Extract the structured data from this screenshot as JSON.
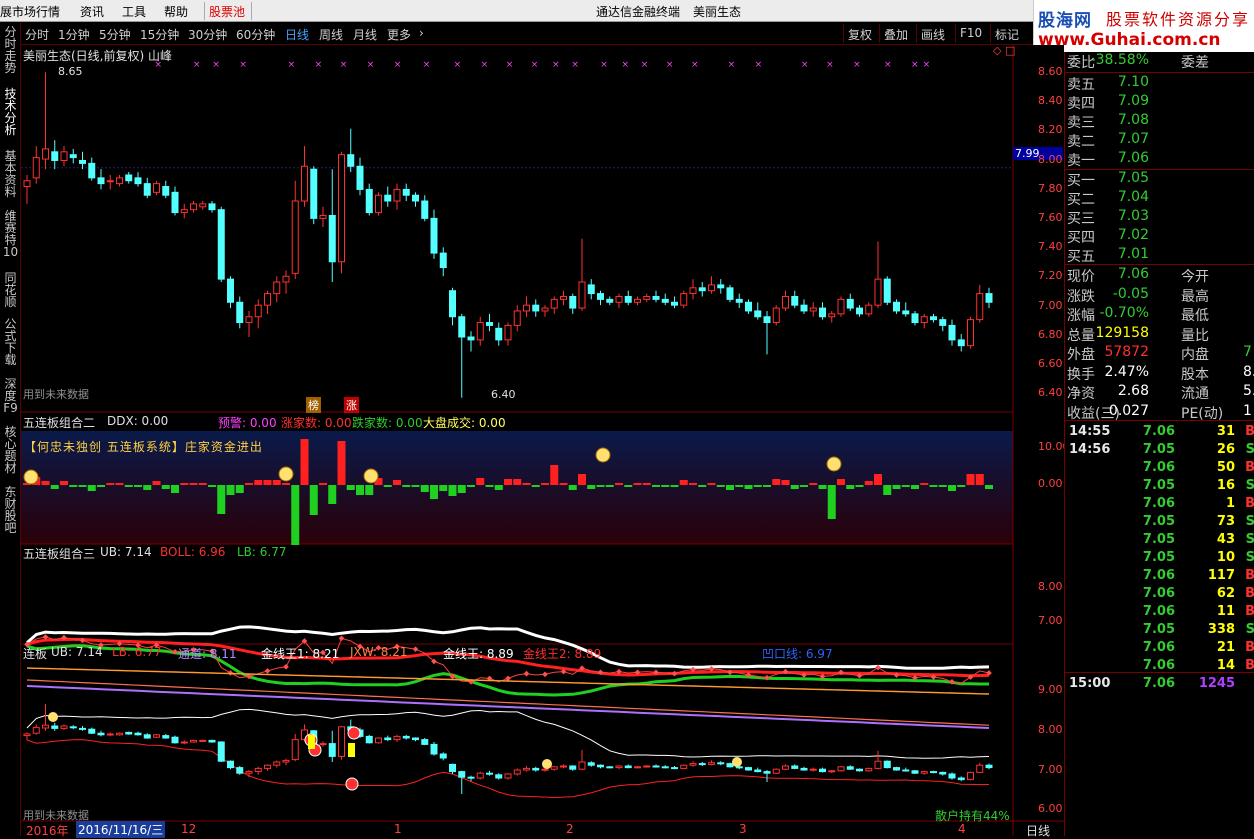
{
  "menu": {
    "items": [
      "展市场行情",
      "资讯",
      "工具",
      "帮助"
    ],
    "highlight": "股票池",
    "app_title": "通达信金融终端",
    "stock_title": "美丽生态"
  },
  "logo": {
    "name": "股海网",
    "tagline": "股票软件资源分享",
    "url": "www.Guhai.com.cn"
  },
  "side_tabs": [
    "分时走势",
    "技术分析",
    "基本资料",
    "维赛特10",
    "同花顺",
    "公式下载",
    "深度F9",
    "核心题材",
    "东财股吧"
  ],
  "periods": [
    "分时",
    "1分钟",
    "5分钟",
    "15分钟",
    "30分钟",
    "60分钟",
    "日线",
    "周线",
    "月线",
    "更多"
  ],
  "active_period": "日线",
  "toolbar_right": [
    "复权",
    "叠加",
    "画线",
    "F10",
    "标记"
  ],
  "main_panel": {
    "title": "美丽生态(日线,前复权) 山峰",
    "high_label": "8.65",
    "low_label": "6.40",
    "marker_a": "榜",
    "marker_b": "涨",
    "footer": "用到未来数据",
    "price_tag": "7.99",
    "y_ticks": [
      "8.60",
      "8.40",
      "8.20",
      "8.00",
      "7.80",
      "7.60",
      "7.40",
      "7.20",
      "7.00",
      "6.80",
      "6.60",
      "6.40"
    ]
  },
  "panel2": {
    "name": "五连板组合二",
    "ddx": "DDX: 0.00",
    "yujing": "预警: 0.00",
    "zhangjia": "涨家数: 0.00",
    "diejia": "跌家数: 0.00",
    "dapan": "大盘成交: 0.00",
    "banner": "【何忠未独创 五连板系统】庄家资金进出",
    "y_ticks": [
      "10.00",
      "0.00"
    ]
  },
  "panel3": {
    "name": "五连板组合三",
    "ub": "UB: 7.14",
    "boll": "BOLL: 6.96",
    "lb": "LB: 6.77",
    "y_ticks": [
      "8.00",
      "7.00"
    ]
  },
  "panel4": {
    "name": "连板",
    "ub": "UB: 7.14",
    "lb": "LB: 6.77",
    "tongdao": "通道: 8.11",
    "jxw1": "金线王1: 8.21",
    "jxw": "JXW: 8.21",
    "jxwang": "金线王: 8.89",
    "jxw2": "金线王2: 8.89",
    "aotu": "凹口线: 6.97",
    "footer": "用到未来数据",
    "retail": "散户持有44%",
    "y_ticks": [
      "9.00",
      "8.00",
      "7.00",
      "6.00"
    ]
  },
  "date_axis": {
    "labels": [
      "2016年",
      "2016/11/16/三",
      "12",
      "1",
      "2",
      "3",
      "4"
    ],
    "period": "日线"
  },
  "quote": {
    "weibi": {
      "k": "委比",
      "v": "-38.58%",
      "k2": "委差"
    },
    "asks": [
      {
        "k": "卖五",
        "v": "7.10"
      },
      {
        "k": "卖四",
        "v": "7.09"
      },
      {
        "k": "卖三",
        "v": "7.08"
      },
      {
        "k": "卖二",
        "v": "7.07"
      },
      {
        "k": "卖一",
        "v": "7.06"
      }
    ],
    "bids": [
      {
        "k": "买一",
        "v": "7.05"
      },
      {
        "k": "买二",
        "v": "7.04"
      },
      {
        "k": "买三",
        "v": "7.03"
      },
      {
        "k": "买四",
        "v": "7.02"
      },
      {
        "k": "买五",
        "v": "7.01"
      }
    ],
    "stats": [
      {
        "k": "现价",
        "v": "7.06",
        "k2": "今开"
      },
      {
        "k": "涨跌",
        "v": "-0.05",
        "k2": "最高"
      },
      {
        "k": "涨幅",
        "v": "-0.70%",
        "k2": "最低"
      },
      {
        "k": "总量",
        "v": "129158",
        "k2": "量比"
      },
      {
        "k": "外盘",
        "v": "57872",
        "k2": "内盘",
        "v2": "7"
      },
      {
        "k": "换手",
        "v": "2.47%",
        "k2": "股本",
        "v2": "8."
      },
      {
        "k": "净资",
        "v": "2.68",
        "k2": "流通",
        "v2": "5."
      },
      {
        "k": "收益(三)",
        "v": "0.027",
        "k2": "PE(动)",
        "v2": "1"
      }
    ],
    "ticks": [
      {
        "t": "14:55",
        "p": "7.06",
        "vol": "31",
        "d": "B"
      },
      {
        "t": "14:56",
        "p": "7.05",
        "vol": "26",
        "d": "S"
      },
      {
        "t": "",
        "p": "7.06",
        "vol": "50",
        "d": "B"
      },
      {
        "t": "",
        "p": "7.05",
        "vol": "16",
        "d": "S"
      },
      {
        "t": "",
        "p": "7.06",
        "vol": "1",
        "d": "B"
      },
      {
        "t": "",
        "p": "7.05",
        "vol": "73",
        "d": "S"
      },
      {
        "t": "",
        "p": "7.05",
        "vol": "43",
        "d": "S"
      },
      {
        "t": "",
        "p": "7.05",
        "vol": "10",
        "d": "S"
      },
      {
        "t": "",
        "p": "7.06",
        "vol": "117",
        "d": "B"
      },
      {
        "t": "",
        "p": "7.06",
        "vol": "62",
        "d": "B"
      },
      {
        "t": "",
        "p": "7.06",
        "vol": "11",
        "d": "B"
      },
      {
        "t": "",
        "p": "7.05",
        "vol": "338",
        "d": "S"
      },
      {
        "t": "",
        "p": "7.06",
        "vol": "21",
        "d": "B"
      },
      {
        "t": "",
        "p": "7.06",
        "vol": "14",
        "d": "B"
      }
    ],
    "close_tick": {
      "t": "15:00",
      "p": "7.06",
      "vol": "1245"
    }
  },
  "colors": {
    "up": "#ff3030",
    "down": "#54ffff",
    "green": "#2ecc2e",
    "yellow": "#ffff00",
    "axis_red": "#7a0000"
  },
  "chart_data": {
    "type": "candlestick",
    "ohlc": [
      [
        7.86,
        7.94,
        7.74,
        7.9
      ],
      [
        7.92,
        8.14,
        7.88,
        8.06
      ],
      [
        8.05,
        8.65,
        7.98,
        8.12
      ],
      [
        8.1,
        8.18,
        7.98,
        8.04
      ],
      [
        8.04,
        8.14,
        8.0,
        8.1
      ],
      [
        8.08,
        8.12,
        8.02,
        8.06
      ],
      [
        8.04,
        8.1,
        7.98,
        8.02
      ],
      [
        8.02,
        8.06,
        7.9,
        7.92
      ],
      [
        7.92,
        7.98,
        7.84,
        7.88
      ],
      [
        7.9,
        7.94,
        7.84,
        7.9
      ],
      [
        7.88,
        7.94,
        7.86,
        7.92
      ],
      [
        7.94,
        7.96,
        7.88,
        7.9
      ],
      [
        7.92,
        7.96,
        7.86,
        7.88
      ],
      [
        7.88,
        7.92,
        7.78,
        7.8
      ],
      [
        7.82,
        7.9,
        7.8,
        7.88
      ],
      [
        7.86,
        7.9,
        7.78,
        7.8
      ],
      [
        7.82,
        7.86,
        7.66,
        7.68
      ],
      [
        7.68,
        7.74,
        7.64,
        7.7
      ],
      [
        7.7,
        7.76,
        7.68,
        7.74
      ],
      [
        7.72,
        7.76,
        7.7,
        7.74
      ],
      [
        7.74,
        7.76,
        7.68,
        7.7
      ],
      [
        7.7,
        7.72,
        7.2,
        7.22
      ],
      [
        7.22,
        7.24,
        7.02,
        7.06
      ],
      [
        7.06,
        7.1,
        6.88,
        6.92
      ],
      [
        6.92,
        7.0,
        6.82,
        6.96
      ],
      [
        6.96,
        7.08,
        6.88,
        7.04
      ],
      [
        7.04,
        7.14,
        6.98,
        7.12
      ],
      [
        7.12,
        7.24,
        7.06,
        7.2
      ],
      [
        7.2,
        7.28,
        7.12,
        7.24
      ],
      [
        7.26,
        7.9,
        7.22,
        7.76
      ],
      [
        7.76,
        8.14,
        7.72,
        8.0
      ],
      [
        7.98,
        8.0,
        7.6,
        7.64
      ],
      [
        7.64,
        7.72,
        7.58,
        7.66
      ],
      [
        7.66,
        7.98,
        7.2,
        7.34
      ],
      [
        7.34,
        8.1,
        7.26,
        8.08
      ],
      [
        8.08,
        8.26,
        7.96,
        8.0
      ],
      [
        8.0,
        8.06,
        7.8,
        7.84
      ],
      [
        7.84,
        7.88,
        7.66,
        7.68
      ],
      [
        7.68,
        7.82,
        7.66,
        7.8
      ],
      [
        7.8,
        7.86,
        7.72,
        7.76
      ],
      [
        7.76,
        7.88,
        7.7,
        7.84
      ],
      [
        7.84,
        7.88,
        7.76,
        7.8
      ],
      [
        7.8,
        7.82,
        7.72,
        7.76
      ],
      [
        7.76,
        7.8,
        7.62,
        7.64
      ],
      [
        7.64,
        7.7,
        7.36,
        7.4
      ],
      [
        7.4,
        7.44,
        7.24,
        7.3
      ],
      [
        7.14,
        7.16,
        6.9,
        6.96
      ],
      [
        6.96,
        6.98,
        6.4,
        6.82
      ],
      [
        6.82,
        6.86,
        6.72,
        6.8
      ],
      [
        6.8,
        6.96,
        6.76,
        6.92
      ],
      [
        6.92,
        6.98,
        6.86,
        6.9
      ],
      [
        6.88,
        6.92,
        6.76,
        6.8
      ],
      [
        6.8,
        6.92,
        6.76,
        6.9
      ],
      [
        6.9,
        7.04,
        6.86,
        7.0
      ],
      [
        7.0,
        7.1,
        6.96,
        7.04
      ],
      [
        7.04,
        7.08,
        6.96,
        7.0
      ],
      [
        7.0,
        7.04,
        6.96,
        7.02
      ],
      [
        7.02,
        7.1,
        6.98,
        7.08
      ],
      [
        7.08,
        7.14,
        7.04,
        7.1
      ],
      [
        7.1,
        7.12,
        6.98,
        7.02
      ],
      [
        7.02,
        7.5,
        7.0,
        7.2
      ],
      [
        7.18,
        7.22,
        7.08,
        7.12
      ],
      [
        7.12,
        7.14,
        7.04,
        7.08
      ],
      [
        7.08,
        7.1,
        7.04,
        7.06
      ],
      [
        7.06,
        7.12,
        7.02,
        7.1
      ],
      [
        7.1,
        7.14,
        7.04,
        7.06
      ],
      [
        7.06,
        7.1,
        7.04,
        7.08
      ],
      [
        7.08,
        7.12,
        7.06,
        7.1
      ],
      [
        7.1,
        7.14,
        7.06,
        7.08
      ],
      [
        7.08,
        7.12,
        7.04,
        7.06
      ],
      [
        7.06,
        7.1,
        7.02,
        7.04
      ],
      [
        7.04,
        7.14,
        7.02,
        7.12
      ],
      [
        7.12,
        7.22,
        7.08,
        7.16
      ],
      [
        7.16,
        7.2,
        7.1,
        7.14
      ],
      [
        7.14,
        7.24,
        7.12,
        7.18
      ],
      [
        7.18,
        7.22,
        7.12,
        7.16
      ],
      [
        7.16,
        7.18,
        7.06,
        7.08
      ],
      [
        7.08,
        7.12,
        7.02,
        7.06
      ],
      [
        7.06,
        7.08,
        6.98,
        7.0
      ],
      [
        7.0,
        7.06,
        6.94,
        6.96
      ],
      [
        6.96,
        7.0,
        6.7,
        6.92
      ],
      [
        6.92,
        7.04,
        6.9,
        7.02
      ],
      [
        7.02,
        7.14,
        7.0,
        7.1
      ],
      [
        7.1,
        7.14,
        7.02,
        7.04
      ],
      [
        7.04,
        7.08,
        6.98,
        7.0
      ],
      [
        7.0,
        7.06,
        6.96,
        7.02
      ],
      [
        7.02,
        7.06,
        6.94,
        6.96
      ],
      [
        6.96,
        7.0,
        6.92,
        6.98
      ],
      [
        6.98,
        7.1,
        6.96,
        7.08
      ],
      [
        7.08,
        7.12,
        7.0,
        7.02
      ],
      [
        7.02,
        7.04,
        6.96,
        6.98
      ],
      [
        6.98,
        7.06,
        6.96,
        7.04
      ],
      [
        7.04,
        7.48,
        7.02,
        7.22
      ],
      [
        7.22,
        7.24,
        7.04,
        7.06
      ],
      [
        7.06,
        7.08,
        6.98,
        7.0
      ],
      [
        7.0,
        7.06,
        6.96,
        6.98
      ],
      [
        6.98,
        7.0,
        6.9,
        6.92
      ],
      [
        6.92,
        6.98,
        6.88,
        6.96
      ],
      [
        6.96,
        6.98,
        6.92,
        6.94
      ],
      [
        6.94,
        6.96,
        6.86,
        6.9
      ],
      [
        6.9,
        6.94,
        6.76,
        6.8
      ],
      [
        6.8,
        6.84,
        6.72,
        6.76
      ],
      [
        6.76,
        6.96,
        6.74,
        6.94
      ],
      [
        6.94,
        7.18,
        6.92,
        7.12
      ],
      [
        7.12,
        7.16,
        7.02,
        7.06
      ]
    ],
    "ub": 7.14,
    "boll": 6.96,
    "lb": 6.77
  }
}
